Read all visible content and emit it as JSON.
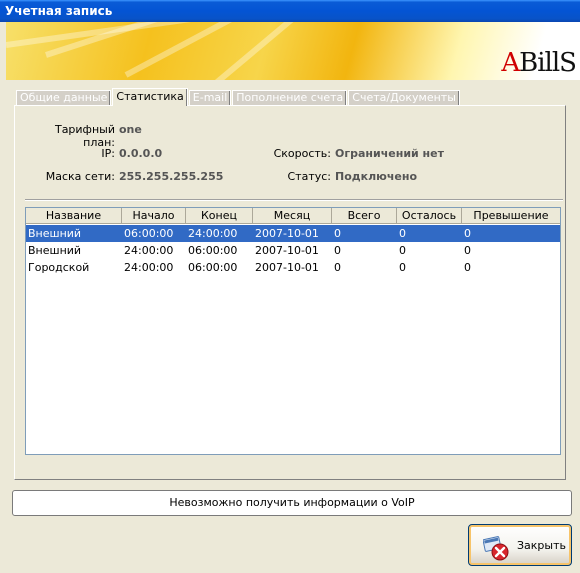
{
  "window": {
    "title": "Учетная запись"
  },
  "logo": {
    "prefix": "A",
    "text": "BillS"
  },
  "tabs": [
    {
      "label": "Общие данные",
      "active": false
    },
    {
      "label": "Статистика",
      "active": true
    },
    {
      "label": "E-mail",
      "active": false
    },
    {
      "label": "Пополнение счета",
      "active": false
    },
    {
      "label": "Счета/Документы",
      "active": false
    }
  ],
  "info": {
    "tariff_label": "Тарифный план:",
    "tariff_value": "one",
    "ip_label": "IP:",
    "ip_value": "0.0.0.0",
    "mask_label": "Маска сети:",
    "mask_value": "255.255.255.255",
    "speed_label": "Скорость:",
    "speed_value": "Ограничений нет",
    "status_label": "Статус:",
    "status_value": "Подключено"
  },
  "table": {
    "columns": [
      "Название",
      "Начало",
      "Конец",
      "Месяц",
      "Всего",
      "Осталось",
      "Превышение"
    ],
    "rows": [
      [
        "Внешний",
        "06:00:00",
        "24:00:00",
        "2007-10-01",
        "0",
        "0",
        "0"
      ],
      [
        "Внешний",
        "24:00:00",
        "06:00:00",
        "2007-10-01",
        "0",
        "0",
        "0"
      ],
      [
        "Городской",
        "24:00:00",
        "06:00:00",
        "2007-10-01",
        "0",
        "0",
        "0"
      ]
    ],
    "selected_row": 0
  },
  "voip_status": "Невозможно получить информации о VoIP",
  "close_button": {
    "label": "Закрыть"
  },
  "colors": {
    "titlebar": "#0454d4",
    "selection": "#316ac5",
    "logo_accent": "#d00000"
  }
}
